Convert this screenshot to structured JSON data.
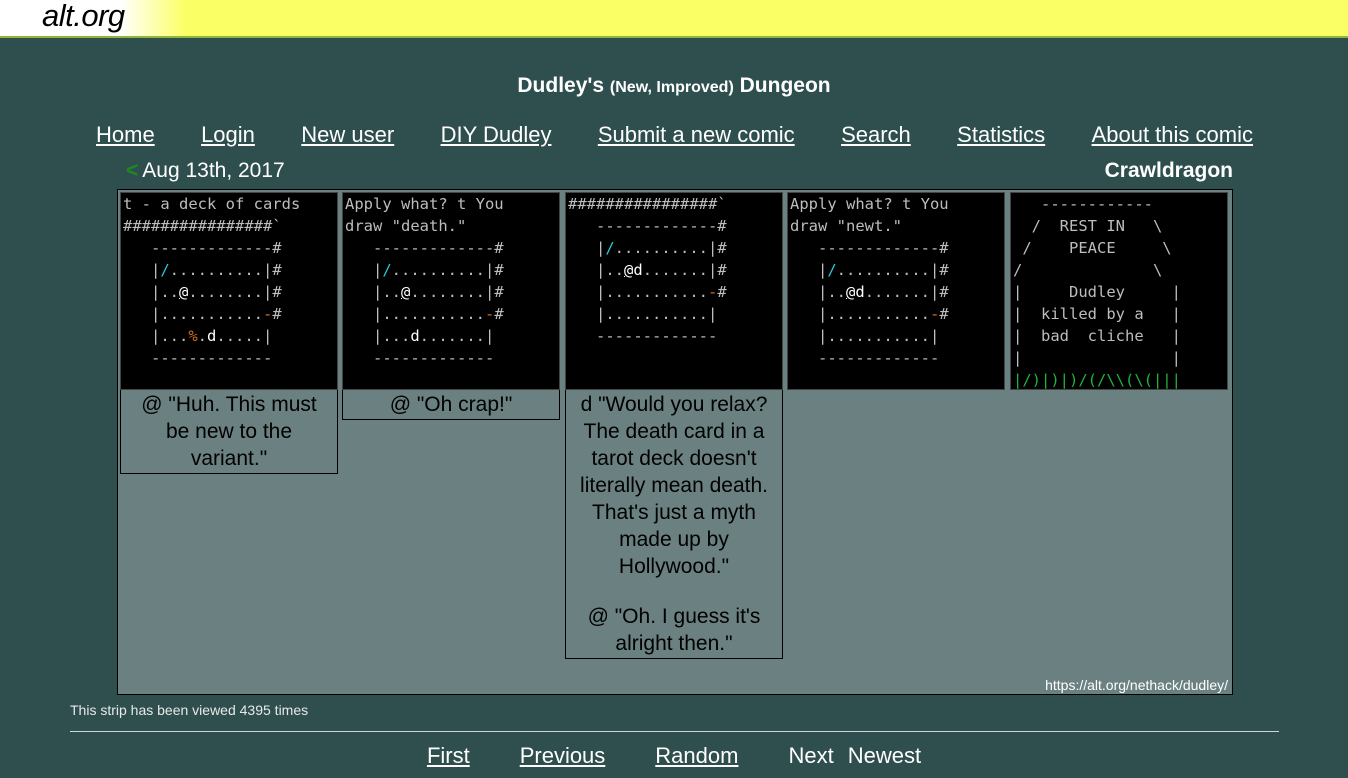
{
  "logo": "alt.org",
  "comic": {
    "title_main_1": "Dudley's",
    "title_paren": "(New, Improved)",
    "title_main_2": "Dungeon"
  },
  "nav": {
    "items": [
      "Home",
      "Login",
      "New user",
      "DIY Dudley",
      "Submit a new comic",
      "Search",
      "Statistics",
      "About this comic"
    ]
  },
  "strip_meta": {
    "prev_arrow": "<",
    "date": "Aug 13th, 2017",
    "author": "Crawldragon"
  },
  "panels": [
    {
      "screen_lines": [
        "t - a deck of cards",
        "################`",
        "   -------------#",
        "   |/..........|#",
        "   |..@........|#",
        "   |...........-#",
        "   |...%.d.....|",
        "   -------------"
      ],
      "captions": [
        "@ \"Huh. This must be new to the variant.\""
      ]
    },
    {
      "screen_lines": [
        "Apply what? t You",
        "draw \"death.\"",
        "   -------------#",
        "   |/..........|#",
        "   |..@........|#",
        "   |...........-#",
        "   |...d.......|",
        "   -------------"
      ],
      "captions": [
        "@ \"Oh crap!\""
      ]
    },
    {
      "screen_lines": [
        "################`",
        "   -------------#",
        "   |/..........|#",
        "   |..@d.......|#",
        "   |...........-#",
        "   |...........|",
        "   -------------"
      ],
      "captions": [
        "d \"Would you relax? The death card in a tarot deck doesn't literally mean death. That's just a myth made up by Hollywood.\"",
        "@ \"Oh. I guess it's alright then.\""
      ]
    },
    {
      "screen_lines": [
        "Apply what? t You",
        "draw \"newt.\"",
        "   -------------#",
        "   |/..........|#",
        "   |..@d.......|#",
        "   |...........-#",
        "   |...........|",
        "   -------------"
      ],
      "captions": []
    },
    {
      "screen_lines": [
        "   ------------",
        "  /  REST IN   \\",
        " /    PEACE     \\",
        "/              \\",
        "|     Dudley     |",
        "|  killed by a   |",
        "|  bad  cliche   |",
        "|                |",
        "|/)|)|)/(/\\\\(\\(|||"
      ],
      "captions": []
    }
  ],
  "strip_url": "https://alt.org/nethack/dudley/",
  "views_text": "This strip has been viewed 4395 times",
  "bottom_nav": {
    "first": "First",
    "previous": "Previous",
    "random": "Random",
    "next": "Next",
    "newest": "Newest"
  },
  "colors": {
    "background": "#2f4f4f",
    "strip_background": "#6b8080",
    "header_yellow": "#fbff66",
    "nethack_cyan": "#29c8d8",
    "nethack_orange": "#d86a1a",
    "nethack_green": "#1fb23a"
  }
}
